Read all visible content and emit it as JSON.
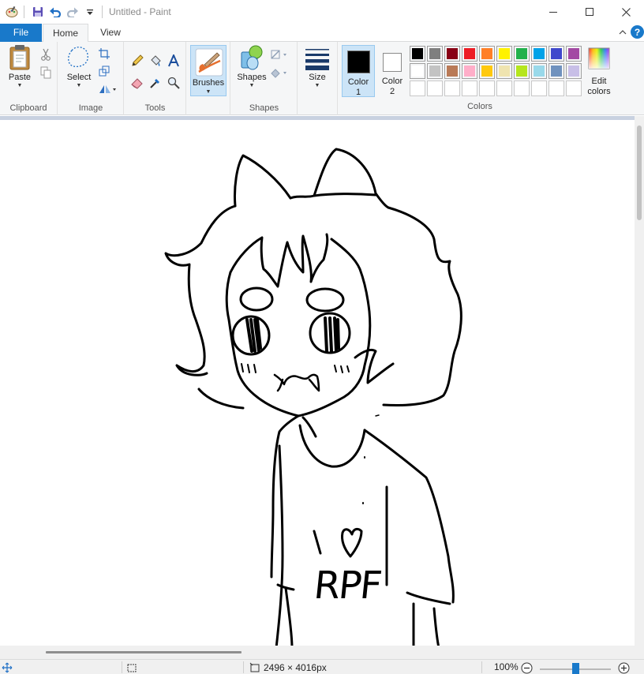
{
  "window": {
    "title": "Untitled - Paint",
    "controls": [
      "minimize",
      "maximize",
      "close"
    ]
  },
  "quick_access": {
    "icons": [
      "paint-app-icon",
      "save-icon",
      "undo-icon",
      "redo-icon",
      "customize-dropdown-icon"
    ]
  },
  "tabs": [
    {
      "label": "File"
    },
    {
      "label": "Home"
    },
    {
      "label": "View"
    }
  ],
  "ribbon": {
    "clipboard": {
      "label": "Clipboard",
      "paste": "Paste"
    },
    "image": {
      "label": "Image",
      "select": "Select"
    },
    "tools": {
      "label": "Tools"
    },
    "brushes": {
      "label": "Brushes"
    },
    "shapes": {
      "label": "Shapes",
      "button": "Shapes"
    },
    "size": {
      "label": "Size"
    },
    "colors": {
      "label": "Colors",
      "color1": "Color",
      "color1_num": "1",
      "color2": "Color",
      "color2_num": "2",
      "edit1": "Edit",
      "edit2": "colors",
      "color1_value": "#000000",
      "color2_value": "#ffffff",
      "palette_row1": [
        "#000000",
        "#7f7f7f",
        "#880015",
        "#ed1c24",
        "#ff7f27",
        "#fff200",
        "#22b14c",
        "#00a2e8",
        "#3f48cc",
        "#a349a4"
      ],
      "palette_row2": [
        "#ffffff",
        "#c3c3c3",
        "#b97a57",
        "#ffaec9",
        "#ffc90e",
        "#efe4b0",
        "#b5e61d",
        "#99d9ea",
        "#7092be",
        "#c8bfe7"
      ]
    }
  },
  "drawing": {
    "shirt_text": "RPF"
  },
  "status": {
    "dimensions": "2496 × 4016px",
    "zoom": "100%"
  }
}
